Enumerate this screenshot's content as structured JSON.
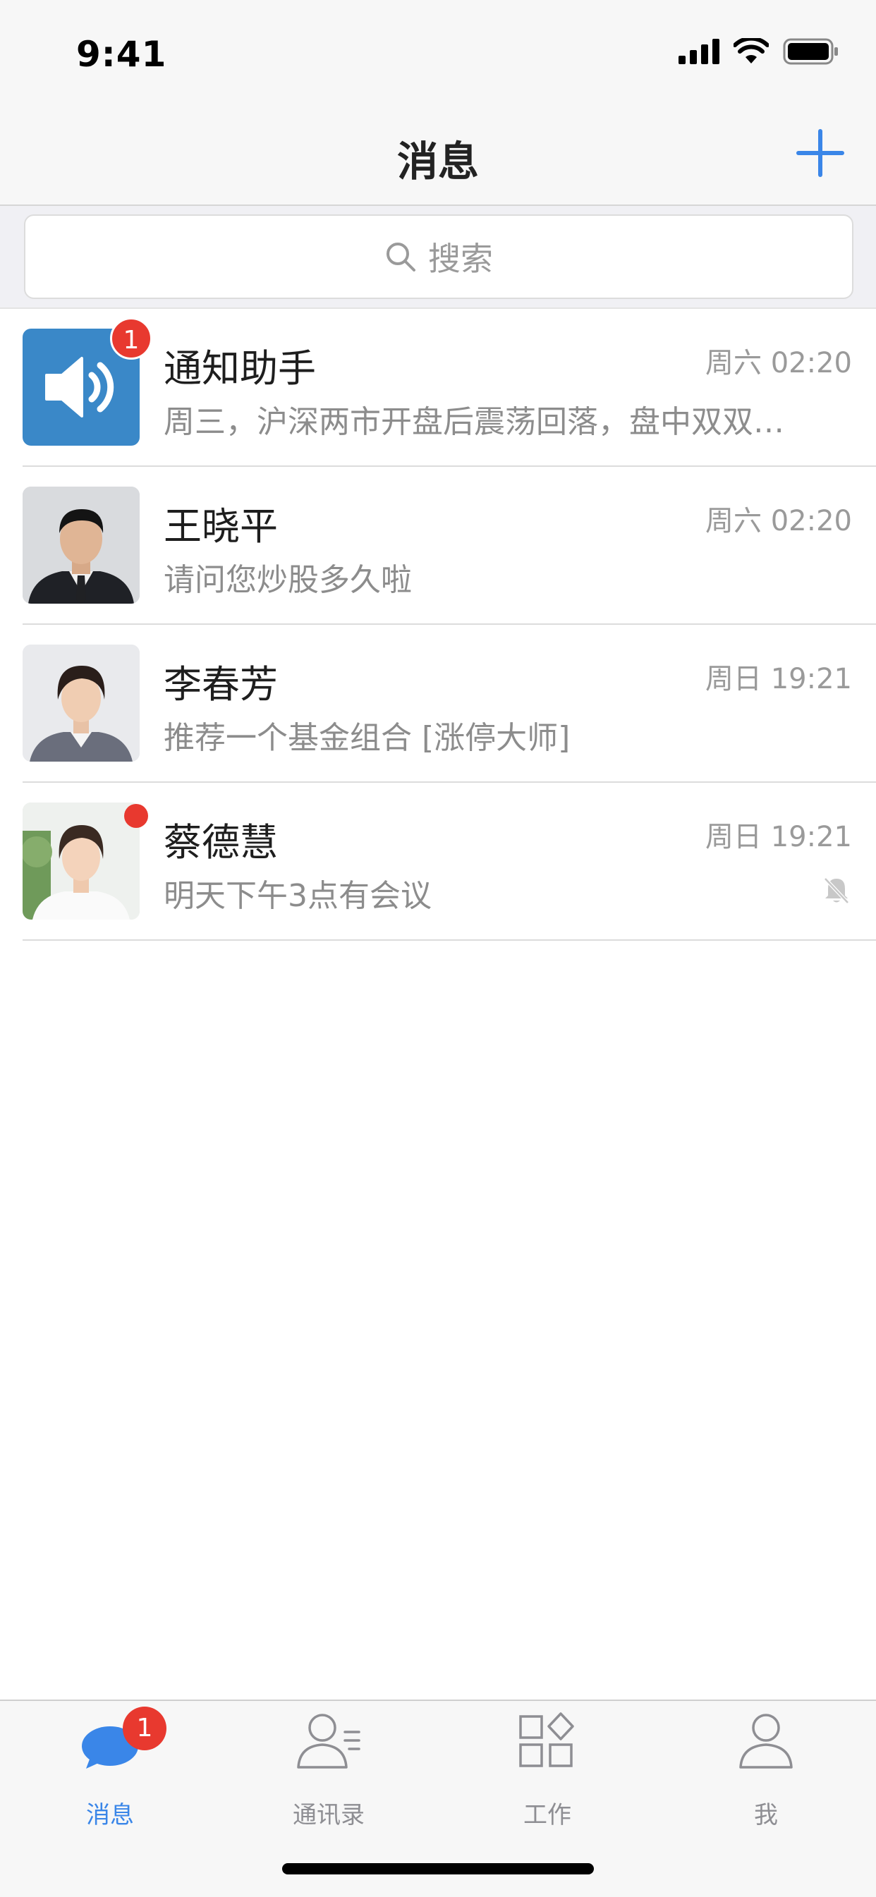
{
  "status_bar": {
    "time": "9:41"
  },
  "nav": {
    "title": "消息",
    "add_icon": "plus-icon"
  },
  "search": {
    "placeholder": "搜索",
    "icon": "search-icon"
  },
  "chats": [
    {
      "name": "通知助手",
      "time": "周六 02:20",
      "preview": "周三，沪深两市开盘后震荡回落，盘中双双…",
      "badge": "1",
      "avatar": "speaker-icon"
    },
    {
      "name": "王晓平",
      "time": "周六 02:20",
      "preview": "请问您炒股多久啦",
      "avatar": "avatar-photo"
    },
    {
      "name": "李春芳",
      "time": "周日 19:21",
      "preview": "推荐一个基金组合 [涨停大师]",
      "avatar": "avatar-photo"
    },
    {
      "name": "蔡德慧",
      "time": "周日 19:21",
      "preview": "明天下午3点有会议",
      "unread_dot": true,
      "muted": true,
      "avatar": "avatar-photo"
    }
  ],
  "tabs": [
    {
      "label": "消息",
      "icon": "chat-bubble-icon",
      "badge": "1",
      "active": true
    },
    {
      "label": "通讯录",
      "icon": "contacts-icon"
    },
    {
      "label": "工作",
      "icon": "apps-icon"
    },
    {
      "label": "我",
      "icon": "person-icon"
    }
  ],
  "colors": {
    "accent": "#3a86e8",
    "badge": "#e8392f",
    "notify_avatar_bg": "#3a88c8"
  }
}
